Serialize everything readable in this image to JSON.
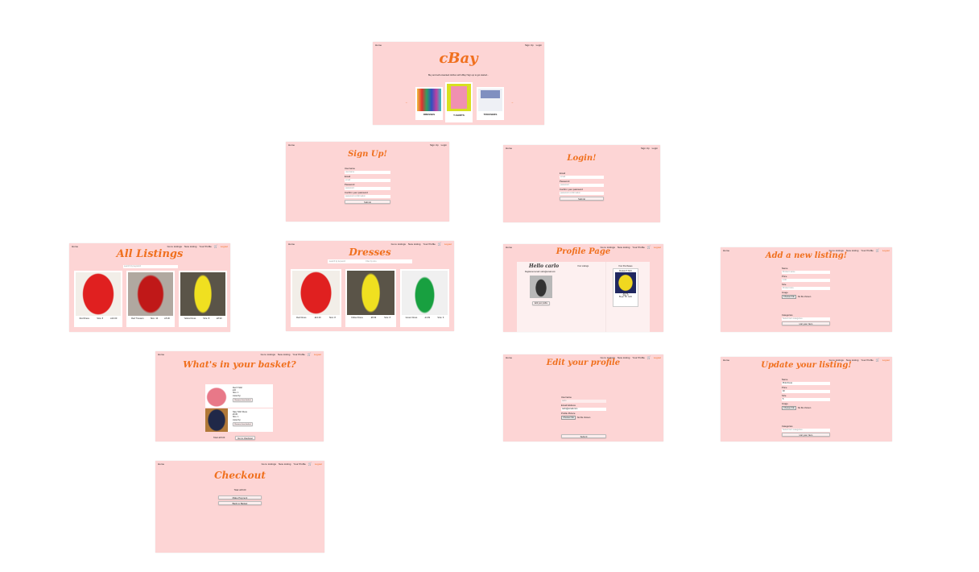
{
  "nav_public": {
    "home": "Home",
    "signup": "Sign Up",
    "login": "Login"
  },
  "nav_user": {
    "home": "Home",
    "listings": "Go to Listings",
    "new": "New Listing",
    "profile": "Your Profile",
    "logout": "Logout"
  },
  "home": {
    "title": "cBay",
    "tagline": "Buy and sell unwanted clothes with cBay! Sign up to get started...",
    "categories": [
      "DRESSES",
      "T-SHIRTS",
      "TROUSERS"
    ],
    "prev": "←",
    "next": "→"
  },
  "signup": {
    "title": "Sign Up!",
    "fields": [
      {
        "label": "Username",
        "placeholder": "username"
      },
      {
        "label": "Email",
        "placeholder": "email"
      },
      {
        "label": "Password",
        "placeholder": "password"
      },
      {
        "label": "Confirm your password",
        "placeholder": "password confirmation"
      }
    ],
    "submit": "Submit"
  },
  "login": {
    "title": "Login!",
    "fields": [
      {
        "label": "Email",
        "placeholder": "email"
      },
      {
        "label": "Password",
        "placeholder": "password"
      },
      {
        "label": "Confirm your password",
        "placeholder": "password confirmation"
      }
    ],
    "submit": "Submit"
  },
  "all_listings": {
    "title": "All Listings",
    "search_placeholder": "search by keyword",
    "items": [
      {
        "name": "Red Dress",
        "size": "Size: 8",
        "price": "£10.00"
      },
      {
        "name": "Red Trousers",
        "size": "Size: 10",
        "price": "£5.00"
      },
      {
        "name": "Yellow Dress",
        "size": "Size: 8",
        "price": "£8.99"
      }
    ]
  },
  "dresses": {
    "title": "Dresses",
    "search_placeholder": "search by keyword",
    "filter_placeholder": "Filter by size",
    "items": [
      {
        "name": "Red Dress",
        "price": "£10.00",
        "size": "Size: 8"
      },
      {
        "name": "Yellow Dress",
        "price": "£8.99",
        "size": "Size: 8"
      },
      {
        "name": "Green Dress",
        "price": "£4.99",
        "size": "Size: 6"
      }
    ]
  },
  "profile": {
    "title": "Profile Page",
    "greeting": "Hello carlo",
    "email": "Registered email: carlo@email.com",
    "edit": "Edit your profile",
    "listings_heading": "Your Listings",
    "purchases_heading": "Your Purchases",
    "purchase": {
      "name": "Mustard T-Shirt",
      "price": "£6.99",
      "size": "Size: 8",
      "buyer": "Buyer: Mr. carlo"
    }
  },
  "add_listing": {
    "title": "Add a new listing!",
    "fields": [
      {
        "label": "Name",
        "placeholder": "Product name"
      },
      {
        "label": "Price",
        "placeholder": "0.00"
      },
      {
        "label": "Size",
        "placeholder": "Product size"
      }
    ],
    "image_label": "Image",
    "choose_file": "Choose File",
    "no_file": "No file chosen",
    "categories_label": "Categories",
    "categories_placeholder": "Select item categories",
    "submit": "List your Item"
  },
  "basket": {
    "title": "What's in your basket?",
    "items": [
      {
        "name": "Red T-Shirt",
        "price": "£10",
        "size": "Size: 1",
        "listed": "Listed by:"
      },
      {
        "name": "Navy Shirt Dress",
        "price": "£5.00",
        "size": "Size: 1",
        "listed": "Listed by:"
      }
    ],
    "remove": "Remove from basket",
    "total": "Total: £15.00",
    "checkout": "Go to checkout"
  },
  "edit_profile": {
    "title": "Edit your profile",
    "username_label": "Username",
    "username_value": "carlo",
    "email_label": "Email Address",
    "email_value": "carlo@email.com",
    "picture_label": "Profile Picture",
    "choose_file": "Choose File",
    "no_file": "No file chosen",
    "submit": "Submit"
  },
  "update_listing": {
    "title": "Update your listing!",
    "fields": [
      {
        "label": "Name",
        "value": "Pink Dress"
      },
      {
        "label": "Price",
        "value": "40"
      },
      {
        "label": "Size",
        "value": "5"
      }
    ],
    "image_label": "Image",
    "choose_file": "Choose File",
    "no_file": "No file chosen",
    "categories_label": "Categories",
    "categories_placeholder": "Select item categories",
    "submit": "List your Item"
  },
  "checkout": {
    "title": "Checkout",
    "total": "Total: £15.00",
    "pay": "Make Payment",
    "back": "Back to Basket"
  }
}
